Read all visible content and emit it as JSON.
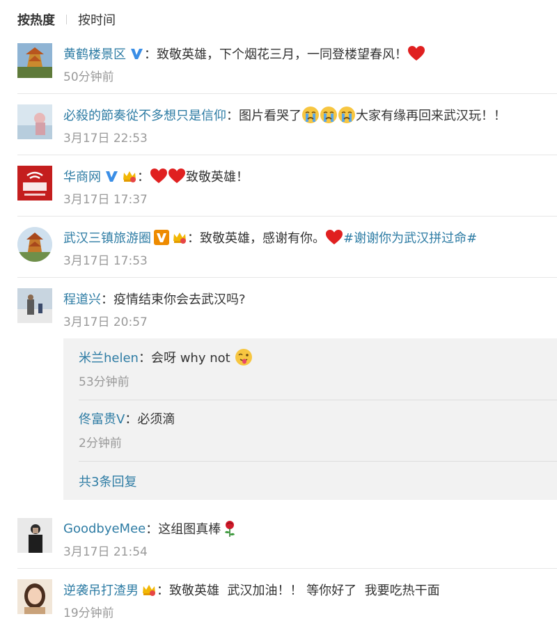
{
  "tabs": {
    "hot": "按热度",
    "time": "按时间"
  },
  "comments": [
    {
      "user": "黄鹤楼景区",
      "text": "致敬英雄，下个烟花三月，一同登楼望春风！",
      "time": "50分钟前"
    },
    {
      "user": "必殺的節奏從不多想只是信仰",
      "text": "图片看哭了",
      "text2": "大家有缘再回来武汉玩！！",
      "time": "3月17日 22:53"
    },
    {
      "user": "华商网",
      "text": "致敬英雄！",
      "time": "3月17日 17:37"
    },
    {
      "user": "武汉三镇旅游圈",
      "text": "致敬英雄，感谢有你。",
      "topic": "#谢谢你为武汉拼过命#",
      "time": "3月17日 17:53"
    },
    {
      "user": "程道兴",
      "text": "疫情结束你会去武汉吗?",
      "time": "3月17日 20:57"
    },
    {
      "user": "GoodbyeMee",
      "text": "这组图真棒",
      "time": "3月17日 21:54"
    },
    {
      "user": "逆袭吊打渣男",
      "text": "致敬英雄  武汉加油！！ 等你好了  我要吃热干面",
      "time": "19分钟前"
    }
  ],
  "replies": [
    {
      "user": "米兰helen",
      "text": "会呀 why not",
      "time": "53分钟前"
    },
    {
      "user": "佟富贵V",
      "text": "必须滴",
      "time": "2分钟前"
    }
  ],
  "replies_more": "共3条回复",
  "colon": "：",
  "colors": {
    "link": "#2e7ca4",
    "text": "#333333",
    "time": "#999999",
    "verified_blue": "#3a8ee6",
    "verified_orange": "#ee8b00",
    "heart": "#e02020"
  },
  "icons": {
    "verified": "verified-v-icon",
    "crown": "crown-badge-icon",
    "heart": "red-heart-icon",
    "cry": "crying-face-icon",
    "wink": "tongue-wink-face-icon",
    "rose": "rose-icon"
  }
}
